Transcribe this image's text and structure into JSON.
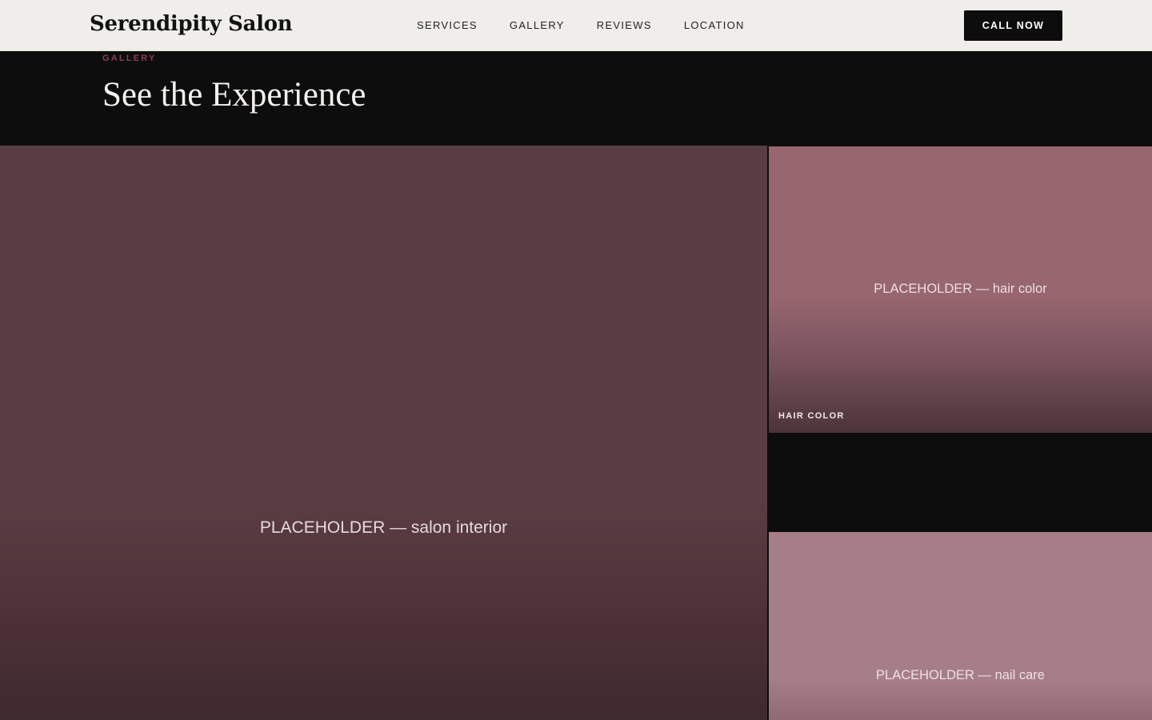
{
  "header": {
    "brand": "Serendipity Salon",
    "nav": [
      {
        "label": "SERVICES"
      },
      {
        "label": "GALLERY"
      },
      {
        "label": "REVIEWS"
      },
      {
        "label": "LOCATION"
      }
    ],
    "cta_label": "CALL NOW"
  },
  "gallery": {
    "eyebrow": "GALLERY",
    "title": "See the Experience",
    "tiles": [
      {
        "placeholder": "PLACEHOLDER — salon interior",
        "caption": ""
      },
      {
        "placeholder": "PLACEHOLDER — hair color",
        "caption": "HAIR COLOR"
      },
      {
        "placeholder": "PLACEHOLDER — nail care",
        "caption": ""
      }
    ]
  },
  "colors": {
    "header_bg": "#efeeea",
    "dark_bg": "#0d0d0d",
    "accent": "#8c3e58",
    "tile_interior": "#5a3d42",
    "tile_hair": "#98666f",
    "tile_nail": "#a67e88"
  }
}
